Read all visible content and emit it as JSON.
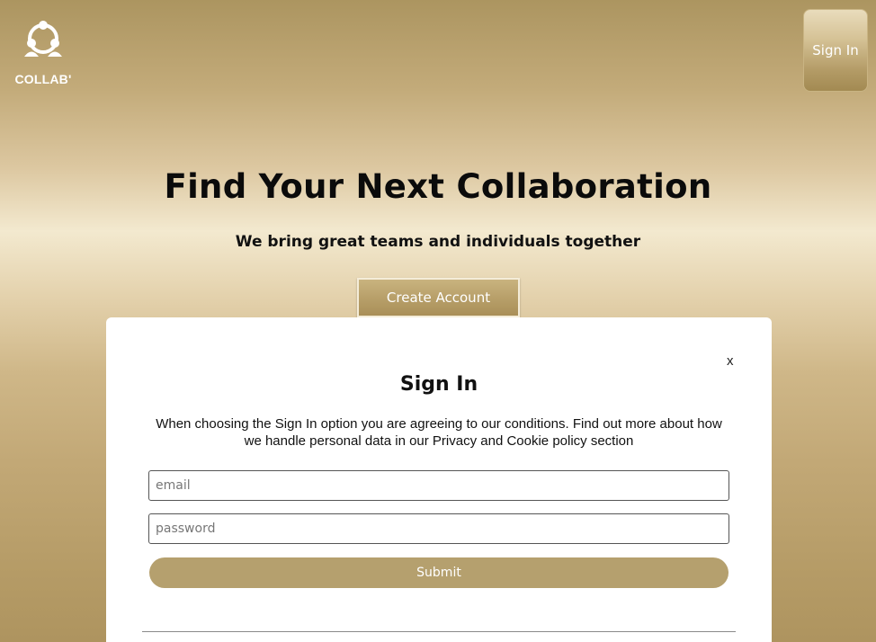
{
  "header": {
    "logo_text": "COLLAB'",
    "logo_icon": "people-circle-icon",
    "sign_in_label": "Sign In"
  },
  "hero": {
    "title": "Find Your Next Collaboration",
    "subtitle": "We bring great teams and individuals together",
    "create_account_label": "Create Account"
  },
  "modal": {
    "close_label": "x",
    "title": "Sign In",
    "description": "When choosing the Sign In option you are agreeing to our conditions. Find out more about how we handle personal data in our Privacy and Cookie policy section",
    "email_placeholder": "email",
    "password_placeholder": "password",
    "submit_label": "Submit"
  },
  "colors": {
    "gold_background": "#c3ab7a",
    "button_gold": "#b5a06e",
    "text_dark": "#111111"
  }
}
